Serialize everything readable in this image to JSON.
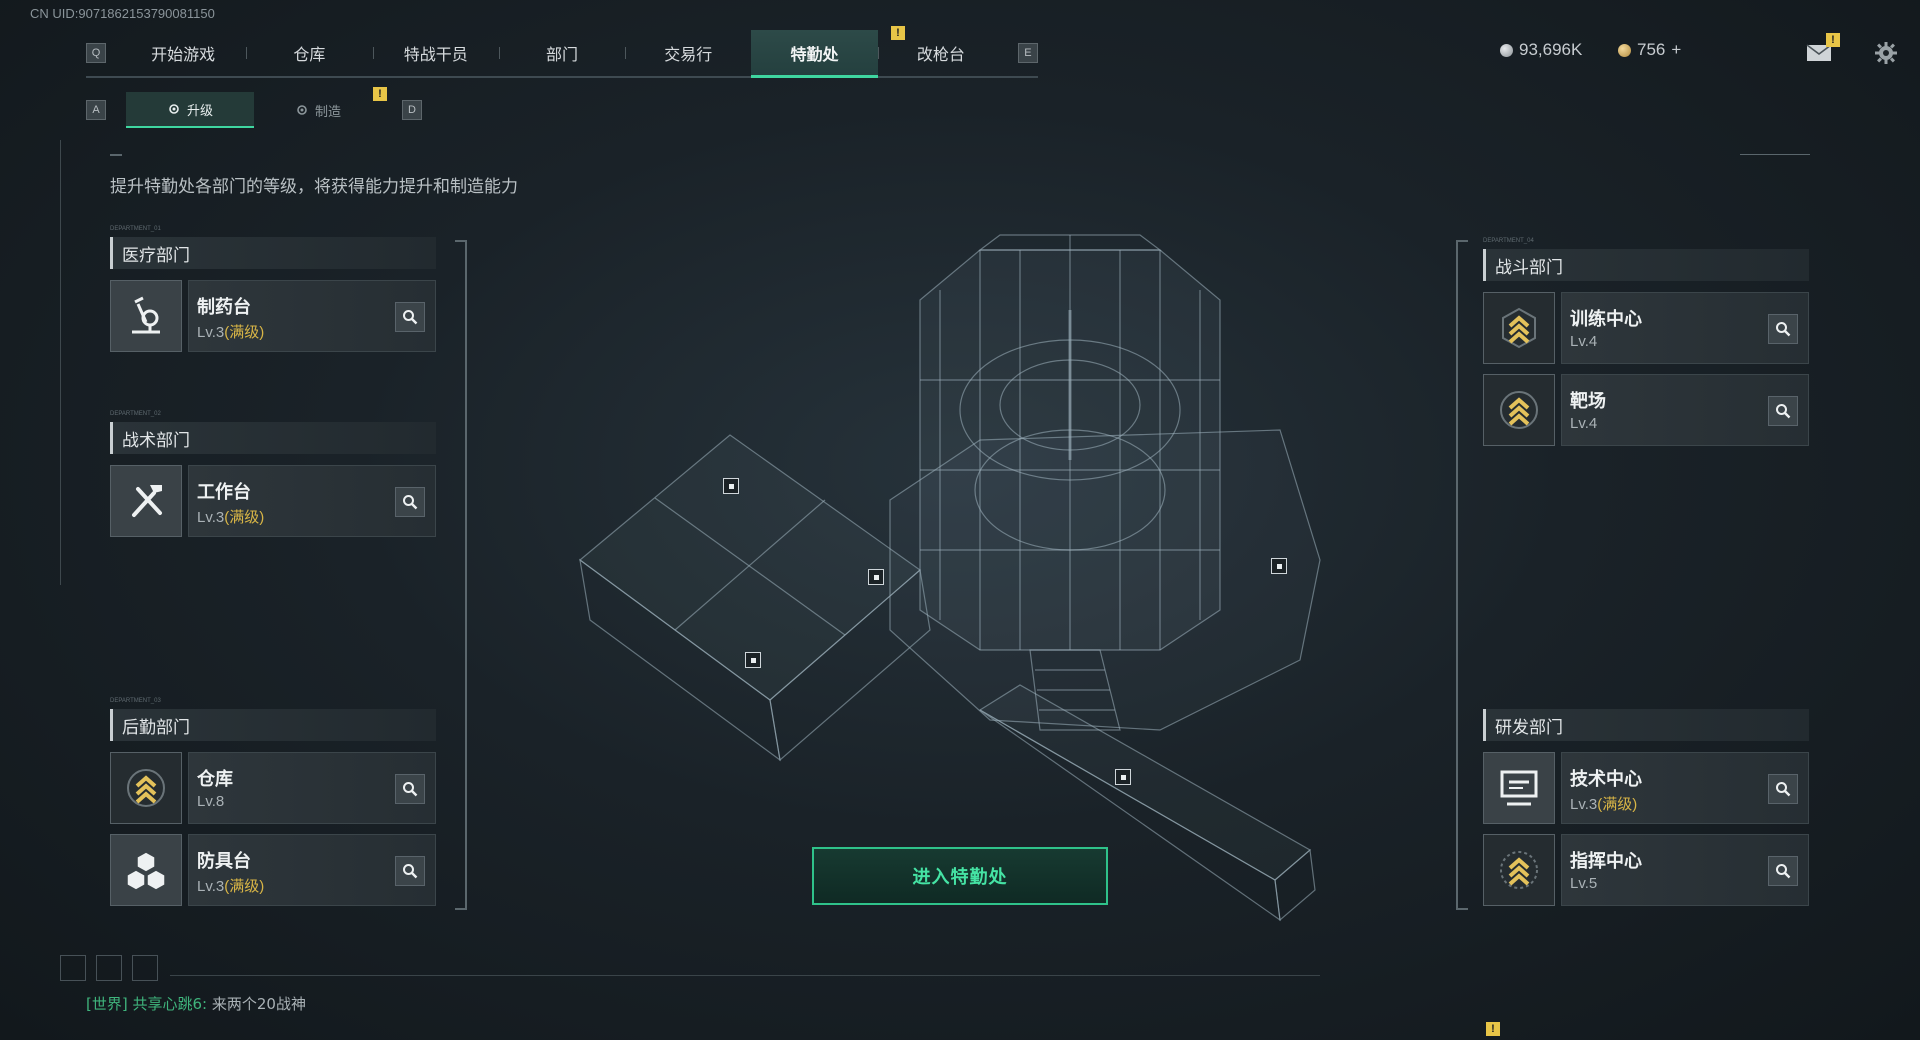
{
  "uid": "CN UID:9071862153790081150",
  "nav": {
    "left_key": "Q",
    "right_key": "E",
    "tabs": [
      "开始游戏",
      "仓库",
      "特战干员",
      "部门",
      "交易行",
      "特勤处",
      "改枪台"
    ],
    "active_tab": "特勤处"
  },
  "subnav": {
    "left_key": "A",
    "right_key": "D",
    "tabs": [
      {
        "label": "升级",
        "active": true
      },
      {
        "label": "制造",
        "active": false
      }
    ]
  },
  "currency": {
    "silver": "93,696K",
    "gold": "756",
    "add": "+"
  },
  "description": "提升特勤处各部门的等级，将获得能力提升和制造能力",
  "departments": {
    "medical": {
      "title": "医疗部门",
      "tag": "DEPARTMENT_01",
      "items": [
        {
          "name": "制药台",
          "level": "Lv.3",
          "max": "(满级)",
          "icon": "microscope-icon"
        }
      ]
    },
    "tactical": {
      "title": "战术部门",
      "tag": "DEPARTMENT_02",
      "items": [
        {
          "name": "工作台",
          "level": "Lv.3",
          "max": "(满级)",
          "icon": "tools-icon"
        }
      ]
    },
    "logistics": {
      "title": "后勤部门",
      "tag": "DEPARTMENT_03",
      "items": [
        {
          "name": "仓库",
          "level": "Lv.8",
          "max": "",
          "icon": "chevrons-icon"
        },
        {
          "name": "防具台",
          "level": "Lv.3",
          "max": "(满级)",
          "icon": "cubes-icon"
        }
      ]
    },
    "combat": {
      "title": "战斗部门",
      "tag": "DEPARTMENT_04",
      "items": [
        {
          "name": "训练中心",
          "level": "Lv.4",
          "max": "",
          "icon": "chevrons-icon"
        },
        {
          "name": "靶场",
          "level": "Lv.4",
          "max": "",
          "icon": "chevrons-icon"
        }
      ]
    },
    "research": {
      "title": "研发部门",
      "tag": "",
      "items": [
        {
          "name": "技术中心",
          "level": "Lv.3",
          "max": "(满级)",
          "icon": "computer-icon"
        },
        {
          "name": "指挥中心",
          "level": "Lv.5",
          "max": "",
          "icon": "chevrons-icon"
        }
      ]
    }
  },
  "enter_button": "进入特勤处",
  "chat": {
    "channel": "[世界]",
    "user": "共享心跳6:",
    "message": "来两个20战神"
  },
  "colors": {
    "accent": "#3fd6a0",
    "max_level": "#d8b546",
    "warning": "#e8c547"
  }
}
